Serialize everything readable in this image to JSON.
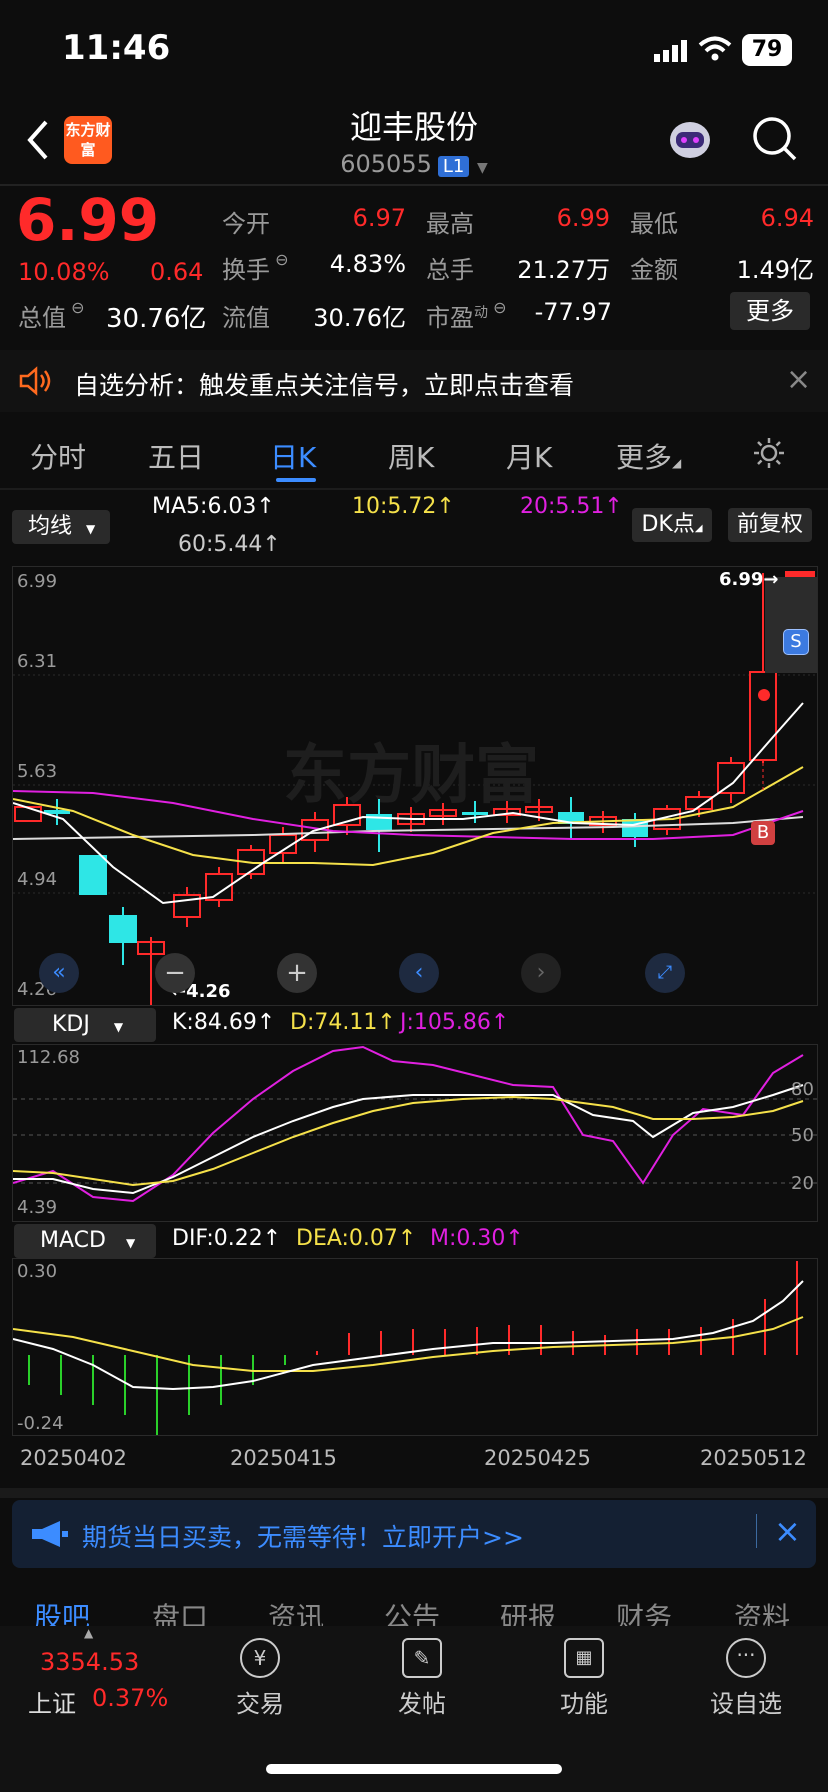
{
  "status": {
    "time": "11:46",
    "battery": "79"
  },
  "nav": {
    "title": "迎丰股份",
    "code": "605055",
    "level_badge": "L1",
    "logo_text": "东方财富"
  },
  "quote": {
    "price": "6.99",
    "change_pct": "10.08%",
    "change_abs": "0.64",
    "open_label": "今开",
    "open": "6.97",
    "high_label": "最高",
    "high": "6.99",
    "low_label": "最低",
    "low": "6.94",
    "turnover_label": "换手",
    "turnover": "4.83%",
    "volume_label": "总手",
    "volume": "21.27万",
    "amount_label": "金额",
    "amount": "1.49亿",
    "mktcap_label": "总值",
    "mktcap": "30.76亿",
    "float_label": "流值",
    "float": "30.76亿",
    "pe_label": "市盈",
    "pe_sup": "动",
    "pe": "-77.97",
    "more_label": "更多"
  },
  "alert": {
    "text": "自选分析：触发重点关注信号，立即点击查看",
    "close": "×"
  },
  "tabs": [
    "分时",
    "五日",
    "日K",
    "周K",
    "月K",
    "更多"
  ],
  "active_tab": "日K",
  "ma_bar": {
    "selector": "均线",
    "ma5": "MA5:6.03↑",
    "ma10": "10:5.72↑",
    "ma20": "20:5.51↑",
    "ma60": "60:5.44↑",
    "dk": "DK点",
    "fq": "前复权"
  },
  "kline": {
    "y_labels": [
      "6.99",
      "6.31",
      "5.63",
      "4.94",
      "4.26"
    ],
    "max_label": "6.99→",
    "min_label": "←4.26",
    "sell_badge": "S",
    "buy_badge": "B"
  },
  "kdj": {
    "selector": "KDJ",
    "k": "K:84.69↑",
    "d": "D:74.11↑",
    "j": "J:105.86↑",
    "y_top": "112.68",
    "y_bottom": "4.39",
    "levels": [
      "80",
      "50",
      "20"
    ]
  },
  "macd": {
    "selector": "MACD",
    "dif": "DIF:0.22↑",
    "dea": "DEA:0.07↑",
    "m": "M:0.30↑",
    "y_top": "0.30",
    "y_bottom": "-0.24"
  },
  "dates": [
    "20250402",
    "20250415",
    "20250425",
    "20250512"
  ],
  "promo": {
    "text": "期货当日买卖，无需等待！立即开户>>",
    "close": "×"
  },
  "bottom_tabs": [
    "股吧",
    "盘口",
    "资讯",
    "公告",
    "研报",
    "财务",
    "资料"
  ],
  "footer": {
    "index_value": "3354.53",
    "index_name": "上证",
    "index_pct": "0.37%",
    "items": [
      "交易",
      "发帖",
      "功能",
      "设自选"
    ]
  },
  "colors": {
    "up": "#ff2a2a",
    "down": "#2ee6e6",
    "accent": "#3c8cff",
    "ma5": "#ffffff",
    "ma10": "#f5e14a",
    "ma20": "#e020e0"
  }
}
